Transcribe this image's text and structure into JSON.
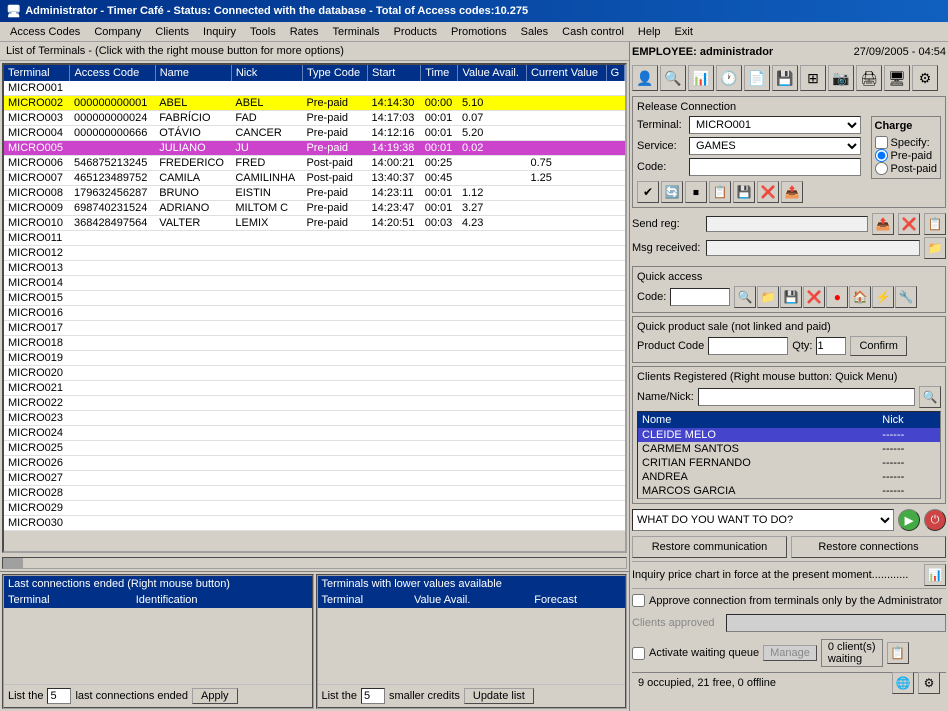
{
  "titleBar": {
    "icon": "☕",
    "text": "Administrator - Timer Café - Status: Connected with the database - Total of Access codes:10.275"
  },
  "menu": {
    "items": [
      "Access Codes",
      "Company",
      "Clients",
      "Inquiry",
      "Tools",
      "Rates",
      "Terminals",
      "Products",
      "Promotions",
      "Sales",
      "Cash control",
      "Help",
      "Exit"
    ]
  },
  "leftPanel": {
    "title": "List of Terminals - (Click with the right mouse button for more options)",
    "tableHeaders": [
      "Terminal",
      "Access Code",
      "Name",
      "Nick",
      "Type Code",
      "Start",
      "Time",
      "Value Avail.",
      "Current Value",
      "G"
    ],
    "rows": [
      {
        "terminal": "MICRO001",
        "accessCode": "",
        "name": "",
        "nick": "",
        "typeCode": "",
        "start": "",
        "time": "",
        "valueAvail": "",
        "currentValue": "",
        "g": "",
        "color": "row-white"
      },
      {
        "terminal": "MICRO002",
        "accessCode": "000000000001",
        "name": "ABEL",
        "nick": "ABEL",
        "typeCode": "Pre-paid",
        "start": "14:14:30",
        "time": "00:00",
        "valueAvail": "5.10",
        "currentValue": "",
        "g": "",
        "color": "row-yellow"
      },
      {
        "terminal": "MICRO003",
        "accessCode": "000000000024",
        "name": "FABRÍCIO",
        "nick": "FAD",
        "typeCode": "Pre-paid",
        "start": "14:17:03",
        "time": "00:01",
        "valueAvail": "0.07",
        "currentValue": "",
        "g": "",
        "color": "row-white"
      },
      {
        "terminal": "MICRO004",
        "accessCode": "000000000666",
        "name": "OTÁVIO",
        "nick": "CANCER",
        "typeCode": "Pre-paid",
        "start": "14:12:16",
        "time": "00:01",
        "valueAvail": "5.20",
        "currentValue": "",
        "g": "",
        "color": "row-white"
      },
      {
        "terminal": "MICRO005",
        "accessCode": "",
        "name": "JULIANO",
        "nick": "JU",
        "typeCode": "Pre-paid",
        "start": "14:19:38",
        "time": "00:01",
        "valueAvail": "0.02",
        "currentValue": "",
        "g": "",
        "color": "row-magenta"
      },
      {
        "terminal": "MICRO006",
        "accessCode": "546875213245",
        "name": "FREDERICO",
        "nick": "FRED",
        "typeCode": "Post-paid",
        "start": "14:00:21",
        "time": "00:25",
        "valueAvail": "",
        "currentValue": "0.75",
        "g": "",
        "color": "row-white"
      },
      {
        "terminal": "MICRO007",
        "accessCode": "465123489752",
        "name": "CAMILA",
        "nick": "CAMILINHA",
        "typeCode": "Post-paid",
        "start": "13:40:37",
        "time": "00:45",
        "valueAvail": "",
        "currentValue": "1.25",
        "g": "",
        "color": "row-white"
      },
      {
        "terminal": "MICRO008",
        "accessCode": "179632456287",
        "name": "BRUNO",
        "nick": "EISTIN",
        "typeCode": "Pre-paid",
        "start": "14:23:11",
        "time": "00:01",
        "valueAvail": "1.12",
        "currentValue": "",
        "g": "",
        "color": "row-white"
      },
      {
        "terminal": "MICRO009",
        "accessCode": "698740231524",
        "name": "ADRIANO",
        "nick": "MILTOM C",
        "typeCode": "Pre-paid",
        "start": "14:23:47",
        "time": "00:01",
        "valueAvail": "3.27",
        "currentValue": "",
        "g": "",
        "color": "row-white"
      },
      {
        "terminal": "MICRO010",
        "accessCode": "368428497564",
        "name": "VALTER",
        "nick": "LEMIX",
        "typeCode": "Pre-paid",
        "start": "14:20:51",
        "time": "00:03",
        "valueAvail": "4.23",
        "currentValue": "",
        "g": "",
        "color": "row-white"
      },
      {
        "terminal": "MICRO011",
        "accessCode": "",
        "name": "",
        "nick": "",
        "typeCode": "",
        "start": "",
        "time": "",
        "valueAvail": "",
        "currentValue": "",
        "g": "",
        "color": "row-white"
      },
      {
        "terminal": "MICRO012",
        "accessCode": "",
        "name": "",
        "nick": "",
        "typeCode": "",
        "start": "",
        "time": "",
        "valueAvail": "",
        "currentValue": "",
        "g": "",
        "color": "row-white"
      },
      {
        "terminal": "MICRO013",
        "accessCode": "",
        "name": "",
        "nick": "",
        "typeCode": "",
        "start": "",
        "time": "",
        "valueAvail": "",
        "currentValue": "",
        "g": "",
        "color": "row-white"
      },
      {
        "terminal": "MICRO014",
        "accessCode": "",
        "name": "",
        "nick": "",
        "typeCode": "",
        "start": "",
        "time": "",
        "valueAvail": "",
        "currentValue": "",
        "g": "",
        "color": "row-white"
      },
      {
        "terminal": "MICRO015",
        "accessCode": "",
        "name": "",
        "nick": "",
        "typeCode": "",
        "start": "",
        "time": "",
        "valueAvail": "",
        "currentValue": "",
        "g": "",
        "color": "row-white"
      },
      {
        "terminal": "MICRO016",
        "accessCode": "",
        "name": "",
        "nick": "",
        "typeCode": "",
        "start": "",
        "time": "",
        "valueAvail": "",
        "currentValue": "",
        "g": "",
        "color": "row-white"
      },
      {
        "terminal": "MICRO017",
        "accessCode": "",
        "name": "",
        "nick": "",
        "typeCode": "",
        "start": "",
        "time": "",
        "valueAvail": "",
        "currentValue": "",
        "g": "",
        "color": "row-white"
      },
      {
        "terminal": "MICRO018",
        "accessCode": "",
        "name": "",
        "nick": "",
        "typeCode": "",
        "start": "",
        "time": "",
        "valueAvail": "",
        "currentValue": "",
        "g": "",
        "color": "row-white"
      },
      {
        "terminal": "MICRO019",
        "accessCode": "",
        "name": "",
        "nick": "",
        "typeCode": "",
        "start": "",
        "time": "",
        "valueAvail": "",
        "currentValue": "",
        "g": "",
        "color": "row-white"
      },
      {
        "terminal": "MICRO020",
        "accessCode": "",
        "name": "",
        "nick": "",
        "typeCode": "",
        "start": "",
        "time": "",
        "valueAvail": "",
        "currentValue": "",
        "g": "",
        "color": "row-white"
      },
      {
        "terminal": "MICRO021",
        "accessCode": "",
        "name": "",
        "nick": "",
        "typeCode": "",
        "start": "",
        "time": "",
        "valueAvail": "",
        "currentValue": "",
        "g": "",
        "color": "row-white"
      },
      {
        "terminal": "MICRO022",
        "accessCode": "",
        "name": "",
        "nick": "",
        "typeCode": "",
        "start": "",
        "time": "",
        "valueAvail": "",
        "currentValue": "",
        "g": "",
        "color": "row-white"
      },
      {
        "terminal": "MICRO023",
        "accessCode": "",
        "name": "",
        "nick": "",
        "typeCode": "",
        "start": "",
        "time": "",
        "valueAvail": "",
        "currentValue": "",
        "g": "",
        "color": "row-white"
      },
      {
        "terminal": "MICRO024",
        "accessCode": "",
        "name": "",
        "nick": "",
        "typeCode": "",
        "start": "",
        "time": "",
        "valueAvail": "",
        "currentValue": "",
        "g": "",
        "color": "row-white"
      },
      {
        "terminal": "MICRO025",
        "accessCode": "",
        "name": "",
        "nick": "",
        "typeCode": "",
        "start": "",
        "time": "",
        "valueAvail": "",
        "currentValue": "",
        "g": "",
        "color": "row-white"
      },
      {
        "terminal": "MICRO026",
        "accessCode": "",
        "name": "",
        "nick": "",
        "typeCode": "",
        "start": "",
        "time": "",
        "valueAvail": "",
        "currentValue": "",
        "g": "",
        "color": "row-white"
      },
      {
        "terminal": "MICRO027",
        "accessCode": "",
        "name": "",
        "nick": "",
        "typeCode": "",
        "start": "",
        "time": "",
        "valueAvail": "",
        "currentValue": "",
        "g": "",
        "color": "row-white"
      },
      {
        "terminal": "MICRO028",
        "accessCode": "",
        "name": "",
        "nick": "",
        "typeCode": "",
        "start": "",
        "time": "",
        "valueAvail": "",
        "currentValue": "",
        "g": "",
        "color": "row-white"
      },
      {
        "terminal": "MICRO029",
        "accessCode": "",
        "name": "",
        "nick": "",
        "typeCode": "",
        "start": "",
        "time": "",
        "valueAvail": "",
        "currentValue": "",
        "g": "",
        "color": "row-white"
      },
      {
        "terminal": "MICRO030",
        "accessCode": "",
        "name": "",
        "nick": "",
        "typeCode": "",
        "start": "",
        "time": "",
        "valueAvail": "",
        "currentValue": "",
        "g": "",
        "color": "row-white"
      }
    ]
  },
  "bottomLeft": {
    "title": "Last connections ended (Right mouse button)",
    "headers": [
      "Terminal",
      "Identification"
    ],
    "listCount": "5",
    "listLabel": "last connections ended",
    "applyBtn": "Apply"
  },
  "bottomRight": {
    "title": "Terminals with lower values available",
    "headers": [
      "Terminal",
      "Value Avail.",
      "Forecast"
    ],
    "listCount": "5",
    "listLabel": "smaller credits",
    "updateBtn": "Update list"
  },
  "rightPanel": {
    "employeeLabel": "EMPLOYEE:",
    "employeeName": "administrador",
    "datetime": "27/09/2005 - 04:54",
    "toolbarIcons": [
      {
        "name": "person-icon",
        "symbol": "👤"
      },
      {
        "name": "search-icon",
        "symbol": "🔍"
      },
      {
        "name": "chart-icon",
        "symbol": "📊"
      },
      {
        "name": "clock-icon",
        "symbol": "🕐"
      },
      {
        "name": "document-icon",
        "symbol": "📄"
      },
      {
        "name": "disk-icon",
        "symbol": "💾"
      },
      {
        "name": "grid-icon",
        "symbol": "⊞"
      },
      {
        "name": "printer-icon",
        "symbol": "🖨"
      },
      {
        "name": "monitor-icon",
        "symbol": "🖥"
      },
      {
        "name": "gear-icon",
        "symbol": "⚙"
      }
    ],
    "releaseConn": {
      "title": "Release Connection",
      "terminalLabel": "Terminal:",
      "terminalValue": "MICRO001",
      "serviceLabel": "Service:",
      "serviceValue": "GAMES",
      "codeLabel": "Code:",
      "chargeTitle": "Charge",
      "specifyLabel": "Specify:",
      "prePaidLabel": "Pre-paid",
      "postPaidLabel": "Post-paid",
      "actionIcons": [
        "✔",
        "🔄",
        "⏹",
        "📋",
        "💾"
      ]
    },
    "messaging": {
      "sendLabel": "Send reg:",
      "receivedLabel": "Msg received:"
    },
    "quickAccess": {
      "title": "Quick access",
      "codeLabel": "Code:",
      "icons": [
        "🔍",
        "📁",
        "💾",
        "❌",
        "🔴",
        "🏠",
        "⚡",
        "🔧"
      ]
    },
    "quickProduct": {
      "title": "Quick product sale (not linked and paid)",
      "productCodeLabel": "Product Code",
      "qtyLabel": "Qty:",
      "qtyValue": "1",
      "confirmBtn": "Confirm"
    },
    "clientsRegistered": {
      "title": "Clients Registered (Right mouse button: Quick Menu)",
      "nameLabel": "Name/Nick:",
      "tableHeaders": [
        "Nome",
        "Nick"
      ],
      "clients": [
        {
          "nome": "CLEIDE MELO",
          "nick": "------"
        },
        {
          "nome": "CARMEM SANTOS",
          "nick": "------"
        },
        {
          "nome": "CRITIAN FERNANDO",
          "nick": "------"
        },
        {
          "nome": "ANDREA",
          "nick": "------"
        },
        {
          "nome": "MARCOS GARCIA",
          "nick": "------"
        }
      ]
    },
    "whatToDo": {
      "label": "WHAT DO YOU WANT TO DO?",
      "options": [
        "WHAT DO YOU WANT TO DO?"
      ]
    },
    "restoreComm": "Restore communication",
    "restoreConn": "Restore connections",
    "priceInquiry": "Inquiry price chart in force at the present moment............",
    "approveLabel": "Approve connection from terminals only by the Administrator",
    "clientsApproved": "Clients approved",
    "waitingQueue": {
      "label": "Activate waiting queue",
      "manageBtn": "Manage",
      "count": "0 client(s)",
      "countLine2": "waiting"
    },
    "statusBar": {
      "text": "9 occupied, 21 free,  0 offline"
    }
  }
}
